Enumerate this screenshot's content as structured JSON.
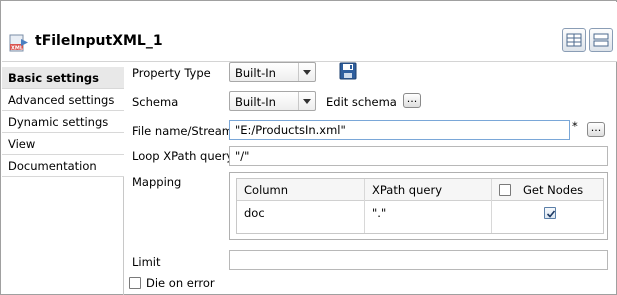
{
  "component": {
    "title": "tFileInputXML_1"
  },
  "sidebar": {
    "tabs": [
      {
        "label": "Basic settings",
        "active": true
      },
      {
        "label": "Advanced settings"
      },
      {
        "label": "Dynamic settings"
      },
      {
        "label": "View"
      },
      {
        "label": "Documentation"
      }
    ]
  },
  "form": {
    "property_type": {
      "label": "Property Type",
      "value": "Built-In"
    },
    "schema": {
      "label": "Schema",
      "value": "Built-In",
      "edit_label": "Edit schema"
    },
    "file_name": {
      "label": "File name/Stream",
      "value": "\"E:/ProductsIn.xml\"",
      "modified_marker": "*"
    },
    "loop_xpath": {
      "label": "Loop XPath query",
      "value": "\"/\""
    },
    "mapping": {
      "label": "Mapping",
      "columns": [
        "Column",
        "XPath query",
        "Get Nodes"
      ],
      "rows": [
        {
          "column": "doc",
          "xpath": "\".\"",
          "get_nodes": true
        }
      ]
    },
    "limit": {
      "label": "Limit",
      "value": ""
    },
    "die_on_error": {
      "label": "Die on error",
      "checked": false
    },
    "dots_label": "..."
  }
}
